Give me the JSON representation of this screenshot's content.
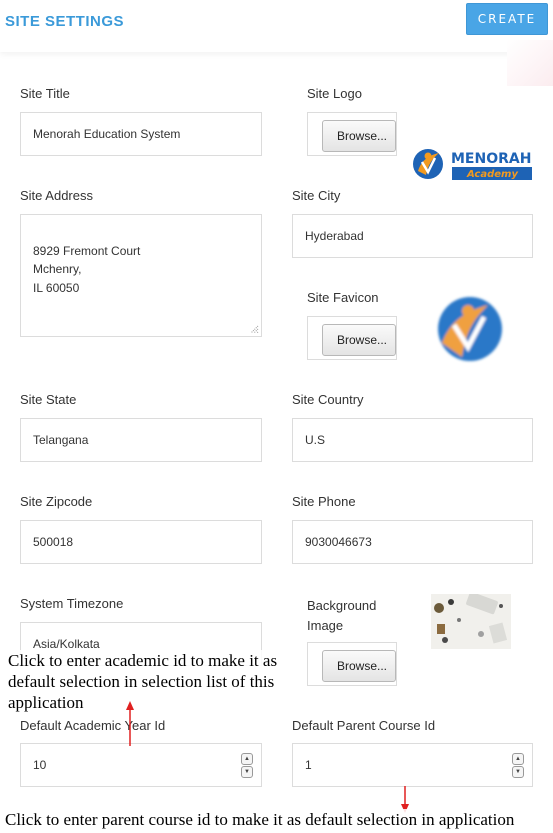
{
  "header": {
    "title": "SITE SETTINGS",
    "create_label": "CREATE"
  },
  "fields": {
    "site_title": {
      "label": "Site Title",
      "value": "Menorah Education System"
    },
    "site_logo": {
      "label": "Site Logo",
      "browse_label": "Browse...",
      "logo_text_1": "MENORAH",
      "logo_text_2": "Academy"
    },
    "site_address": {
      "label": "Site Address",
      "value": "8929 Fremont Court\nMchenry,\nIL 60050"
    },
    "site_city": {
      "label": "Site City",
      "value": "Hyderabad"
    },
    "site_favicon": {
      "label": "Site Favicon",
      "browse_label": "Browse..."
    },
    "site_state": {
      "label": "Site State",
      "value": "Telangana"
    },
    "site_country": {
      "label": "Site Country",
      "value": "U.S"
    },
    "site_zipcode": {
      "label": "Site Zipcode",
      "value": "500018"
    },
    "site_phone": {
      "label": "Site Phone",
      "value": "9030046673"
    },
    "system_timezone": {
      "label": "System Timezone",
      "value": "Asia/Kolkata"
    },
    "background_image": {
      "label": "Background Image",
      "browse_label": "Browse..."
    },
    "default_academic_year_id": {
      "label": "Default Academic Year Id",
      "value": "10"
    },
    "default_parent_course_id": {
      "label": "Default Parent Course Id",
      "value": "1"
    }
  },
  "annotations": {
    "academic_note": "Click to enter academic id to make it as default selection in selection list of this application",
    "parent_course_note": "Click to enter parent course id to make it as default selection in application"
  },
  "colors": {
    "accent": "#3b9ad9",
    "button": "#49a5e6",
    "arrow": "#e02020"
  },
  "icons": {
    "spinner_up": "chevron-up-icon",
    "spinner_down": "chevron-down-icon",
    "resize": "resize-grip-icon"
  }
}
